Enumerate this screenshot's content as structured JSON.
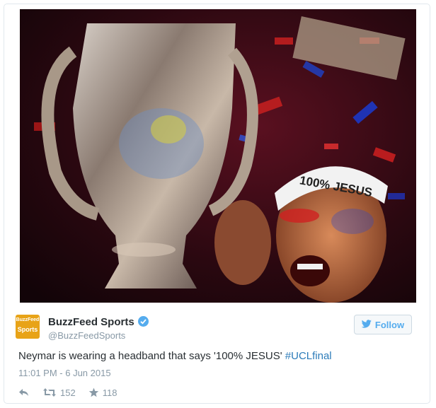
{
  "media": {
    "alt": "",
    "headband_text": "100% JESUS"
  },
  "author": {
    "avatar_line1": "BuzzFeed",
    "avatar_line2": "Sports",
    "name": "BuzzFeed Sports",
    "handle": "@BuzzFeedSports",
    "verified": true
  },
  "follow_button": {
    "label": "Follow",
    "icon": "bird-icon"
  },
  "tweet": {
    "text": "Neymar is wearing a headband that says '100% JESUS'",
    "hashtag": "#UCLfinal",
    "timestamp": "11:01 PM - 6 Jun 2015"
  },
  "actions": {
    "reply_icon": "reply-icon",
    "retweet_icon": "retweet-icon",
    "retweet_count": "152",
    "favorite_icon": "star-icon",
    "favorite_count": "118"
  },
  "colors": {
    "accent": "#55acee",
    "link": "#2b7bb9",
    "avatar": "#e8a317",
    "text": "#292f33",
    "muted": "#8899a6"
  }
}
